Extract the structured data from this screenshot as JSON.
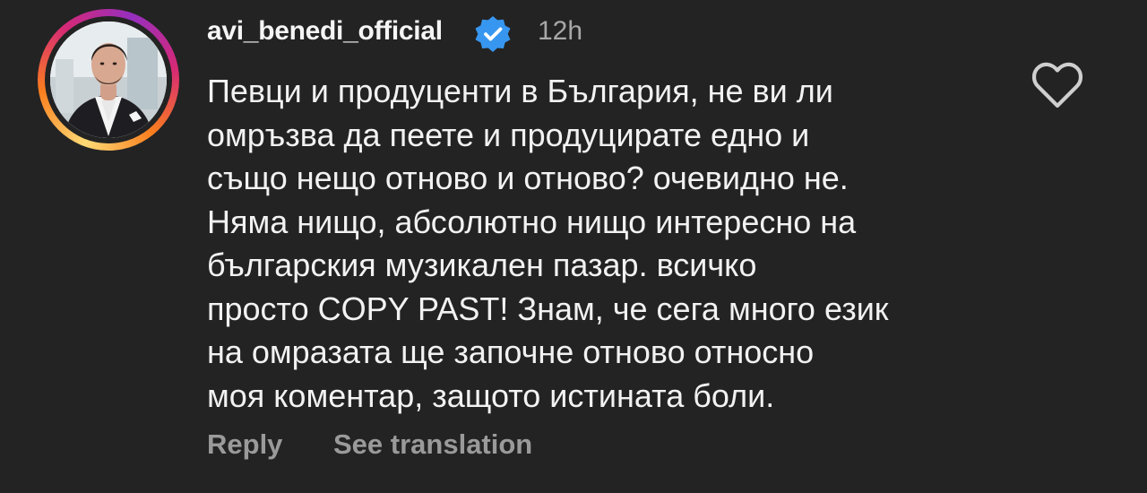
{
  "comment": {
    "username": "avi_benedi_official",
    "verified": true,
    "timestamp": "12h",
    "text": "Певци и продуценти в България, не ви ли\nомръзва да пеете и продуцирате едно и\nсъщо нещо отново и отново? очевидно не.\nНяма нищо, абсолютно нищо интересно на\nбългарския музикален пазар. всичко\nпросто COPY PAST! Знам, че сега много език\nна омразата ще започне отново относно\nмоя коментар, защото истината боли.",
    "reply_label": "Reply",
    "translation_label": "See translation",
    "icons": {
      "like": "heart-outline-icon",
      "verified": "verified-badge-icon"
    }
  },
  "colors": {
    "background": "#232323",
    "text": "#f2f2f2",
    "muted": "#a8a8a8",
    "verified": "#3797f0"
  }
}
